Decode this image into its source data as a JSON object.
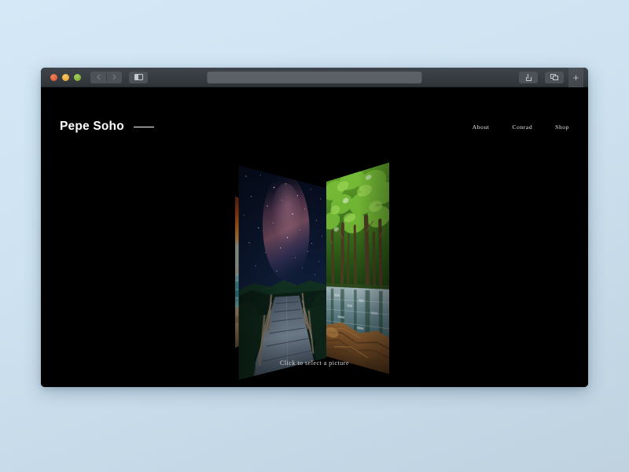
{
  "desktop": {
    "background_top": "#d4e8f7",
    "background_bottom": "#bfd2e0"
  },
  "browser": {
    "traffic_lights": [
      {
        "name": "close",
        "color": "#d9552c"
      },
      {
        "name": "minimize",
        "color": "#e3a02c"
      },
      {
        "name": "zoom",
        "color": "#73a62c"
      }
    ],
    "back_label": "‹",
    "forward_label": "›",
    "sidebar_label": "",
    "address_value": "",
    "address_placeholder": "",
    "share_label": "",
    "tabs_label": "",
    "new_tab_label": "+"
  },
  "site": {
    "brand": "Pepe Soho",
    "nav": [
      {
        "label": "About"
      },
      {
        "label": "Conrad"
      },
      {
        "label": "Shop"
      }
    ],
    "gallery": {
      "caption": "Click to select a picture",
      "panels": [
        {
          "name": "sunset-beach",
          "alt": "Sunset over tropical beach",
          "position": "left"
        },
        {
          "name": "milky-way-boardwalk",
          "alt": "Milky Way over wooden boardwalk",
          "position": "center"
        },
        {
          "name": "forest-reflection",
          "alt": "Green forest reflected in still water",
          "position": "right"
        }
      ]
    },
    "background": "#000000",
    "text_color": "#ffffff"
  }
}
